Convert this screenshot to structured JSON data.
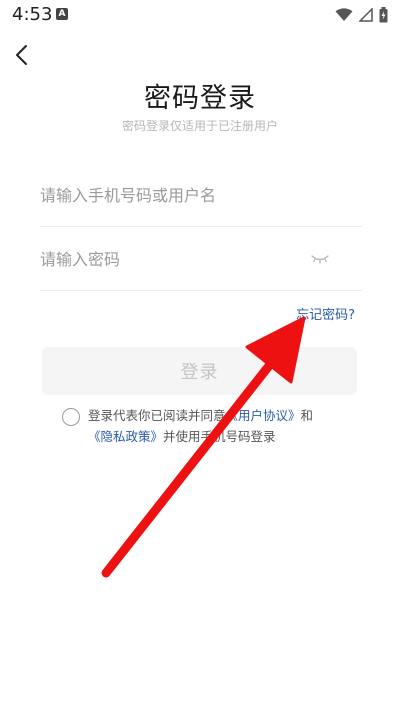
{
  "status_bar": {
    "time": "4:53",
    "notification_letter": "A"
  },
  "header": {
    "title": "密码登录",
    "subtitle": "密码登录仅适用于已注册用户"
  },
  "form": {
    "phone_placeholder": "请输入手机号码或用户名",
    "password_placeholder": "请输入密码",
    "forgot_label": "忘记密码?",
    "login_label": "登录"
  },
  "agreement": {
    "prefix": "登录代表你已阅读并同意",
    "user_agreement": "《用户协议》",
    "and": "和",
    "privacy_policy": "《隐私政策》",
    "suffix": "并使用手机号码登录"
  },
  "icons": {
    "back": "chevron-left-icon",
    "eye": "eye-closed-icon",
    "wifi": "wifi-icon",
    "signal": "signal-icon",
    "battery": "battery-icon"
  },
  "colors": {
    "link": "#2a5caa",
    "annotation": "#ee1111",
    "button_bg": "#f5f5f5",
    "button_text": "#c4c4c4"
  }
}
